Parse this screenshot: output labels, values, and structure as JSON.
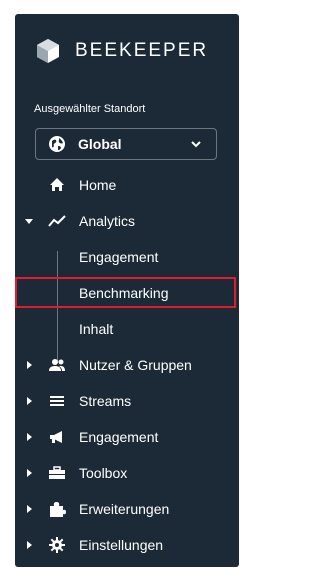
{
  "brand": {
    "name": "BEEKEEPER",
    "logo_icon": "beekeeper-logo-icon"
  },
  "location": {
    "label": "Ausgewählter Standort",
    "value": "Global",
    "icon": "globe-icon"
  },
  "nav": {
    "home": "Home",
    "analytics": "Analytics",
    "analytics_sub": [
      "Engagement",
      "Benchmarking",
      "Inhalt"
    ],
    "nutzer": "Nutzer & Gruppen",
    "streams": "Streams",
    "engagement": "Engagement",
    "toolbox": "Toolbox",
    "erweiterungen": "Erweiterungen",
    "einstellungen": "Einstellungen"
  },
  "colors": {
    "sidebar_bg": "#1b2a36",
    "text": "#ffffff",
    "highlight_border": "#e01e2b"
  }
}
